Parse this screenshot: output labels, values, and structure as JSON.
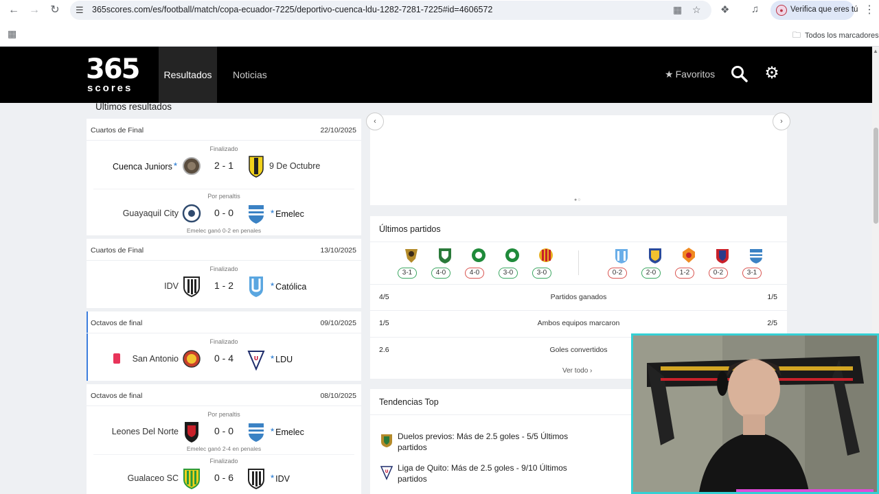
{
  "browser": {
    "url": "365scores.com/es/football/match/copa-ecuador-7225/deportivo-cuenca-ldu-1282-7281-7225#id=4606572",
    "profile_label": "Verifica que eres tú",
    "bookmarks_label": "Todos los marcadores"
  },
  "header": {
    "logo_number": "365",
    "logo_word": "scores",
    "nav_results": "Resultados",
    "nav_news": "Noticias",
    "favorites": "Favoritos"
  },
  "recent": {
    "title": "Últimos resultados",
    "cards": [
      {
        "stage": "Cuartos de Final",
        "date": "22/10/2025",
        "matches": [
          {
            "status": "Finalizado",
            "home": "Cuenca Juniors",
            "score": "2 - 1",
            "away": "9 De Octubre",
            "note": ""
          },
          {
            "status": "Por penaltis",
            "home": "Guayaquil City",
            "score": "0 - 0",
            "away": "Emelec",
            "note": "Emelec ganó 0-2 en penales"
          }
        ]
      },
      {
        "stage": "Cuartos de Final",
        "date": "13/10/2025",
        "matches": [
          {
            "status": "Finalizado",
            "home": "IDV",
            "score": "1 - 2",
            "away": "Católica",
            "note": ""
          }
        ]
      },
      {
        "stage": "Octavos de final",
        "date": "09/10/2025",
        "matches": [
          {
            "status": "Finalizado",
            "home": "San Antonio",
            "score": "0 - 4",
            "away": "LDU",
            "note": ""
          }
        ]
      },
      {
        "stage": "Octavos de final",
        "date": "08/10/2025",
        "matches": [
          {
            "status": "Por penaltis",
            "home": "Leones Del Norte",
            "score": "0 - 0",
            "away": "Emelec",
            "note": "Emelec ganó 2-4 en penales"
          },
          {
            "status": "Finalizado",
            "home": "Gualaceo SC",
            "score": "0 - 6",
            "away": "IDV",
            "note": ""
          }
        ]
      }
    ]
  },
  "last_matches": {
    "title": "Últimos partidos",
    "left_form": [
      {
        "score": "3-1",
        "result": "win"
      },
      {
        "score": "4-0",
        "result": "win"
      },
      {
        "score": "4-0",
        "result": "loss"
      },
      {
        "score": "3-0",
        "result": "win"
      },
      {
        "score": "3-0",
        "result": "win"
      }
    ],
    "right_form": [
      {
        "score": "0-2",
        "result": "loss"
      },
      {
        "score": "2-0",
        "result": "win"
      },
      {
        "score": "1-2",
        "result": "loss"
      },
      {
        "score": "0-2",
        "result": "loss"
      },
      {
        "score": "3-1",
        "result": "loss"
      }
    ],
    "stats": [
      {
        "left": "4/5",
        "label": "Partidos ganados",
        "right": "1/5"
      },
      {
        "left": "1/5",
        "label": "Ambos equipos marcaron",
        "right": "2/5"
      },
      {
        "left": "2.6",
        "label": "Goles convertidos",
        "right": ""
      }
    ],
    "see_all": "Ver todo"
  },
  "trends": {
    "title": "Tendencias Top",
    "items": [
      {
        "text": "Duelos previos: Más de 2.5 goles - 5/5 Últimos partidos"
      },
      {
        "text": "Liga de Quito: Más de 2.5 goles - 9/10 Últimos partidos"
      }
    ]
  },
  "colors": {
    "accent": "#3b7ddd",
    "win": "#3aa660",
    "loss": "#d9534f",
    "webcam_border": "#35d0d4"
  }
}
